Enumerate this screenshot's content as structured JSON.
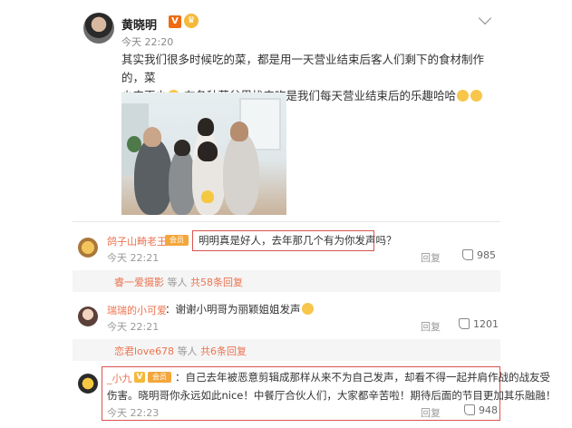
{
  "post": {
    "author": "黄晓明",
    "v_badge": "V",
    "time": "今天 22:20",
    "text_line1": "其实我们很多时候吃的菜，都是用一天营业结束后客人们剩下的食材制作的，菜",
    "text_line2a": "少肉更少",
    "text_line2b": "在各种菜盆里找肉吃是我们每天营业结束后的乐趣哈哈"
  },
  "comments": [
    {
      "name": "鸽子山畸老王",
      "text": "明明真是好人，去年那几个有为你发声吗？",
      "time": "今天 22:21",
      "reply": "回复",
      "likes": "985",
      "sub_user": "睿一爱摄影",
      "sub_text": "等人",
      "sub_count": "共58条回复"
    },
    {
      "name": "瑞瑞的小可爱",
      "text": "谢谢小明哥为丽颖姐姐发声",
      "time": "今天 22:21",
      "reply": "回复",
      "likes": "1201",
      "sub_user": "恋君love678",
      "sub_text": "等人",
      "sub_count": "共6条回复"
    },
    {
      "name": "_小九",
      "v_badge": "V",
      "text_line1": "自己去年被恶意剪辑成那样从来不为自己发声，却看不得一起并肩作战的战友受",
      "text_line2": "伤害。晓明哥你永远如此nice！中餐厅合伙人们，大家都辛苦啦！期待后面的节目更加其乐融融！",
      "time": "今天 22:23",
      "reply": "回复",
      "likes": "948"
    }
  ],
  "colors": {
    "username": "#eb7350",
    "highlight_box": "#d9534f",
    "v_badge": "#f06a0f"
  },
  "icons": [
    "chevron-down-icon",
    "thumb-up-icon",
    "crown-icon",
    "emoji-icon"
  ]
}
